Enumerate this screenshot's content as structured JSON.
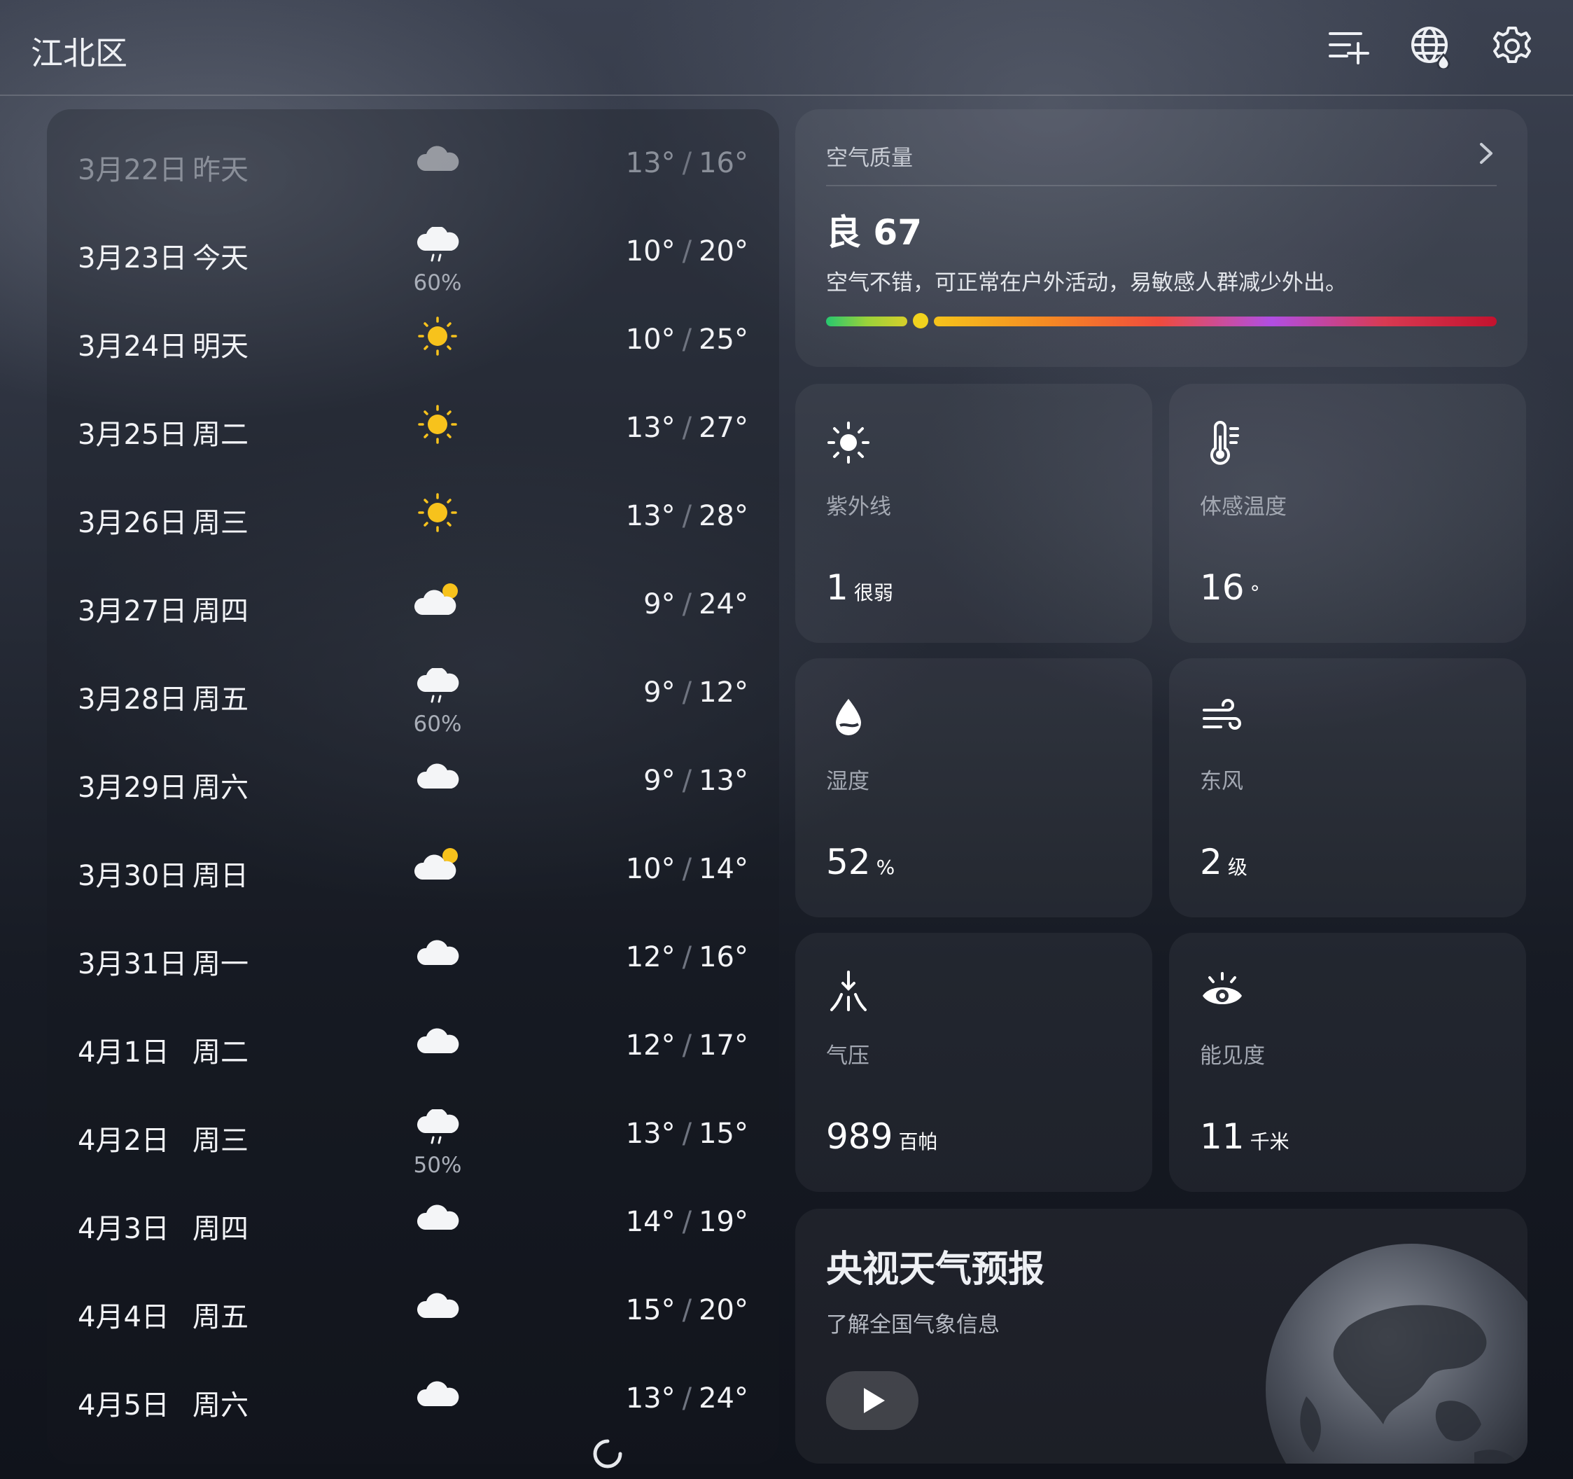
{
  "header": {
    "city": "江北区",
    "icons": [
      "add-list-icon",
      "globe-icon",
      "settings-icon"
    ]
  },
  "forecast": [
    {
      "date": "3月22日",
      "day": "昨天",
      "icon": "cloud-icon",
      "precip": "",
      "low": "13°",
      "high": "16°",
      "past": true
    },
    {
      "date": "3月23日",
      "day": "今天",
      "icon": "rain-icon",
      "precip": "60%",
      "low": "10°",
      "high": "20°",
      "past": false
    },
    {
      "date": "3月24日",
      "day": "明天",
      "icon": "sun-icon",
      "precip": "",
      "low": "10°",
      "high": "25°",
      "past": false
    },
    {
      "date": "3月25日",
      "day": "周二",
      "icon": "sun-icon",
      "precip": "",
      "low": "13°",
      "high": "27°",
      "past": false
    },
    {
      "date": "3月26日",
      "day": "周三",
      "icon": "sun-icon",
      "precip": "",
      "low": "13°",
      "high": "28°",
      "past": false
    },
    {
      "date": "3月27日",
      "day": "周四",
      "icon": "partly-cloudy-icon",
      "precip": "",
      "low": "9°",
      "high": "24°",
      "past": false
    },
    {
      "date": "3月28日",
      "day": "周五",
      "icon": "rain-icon",
      "precip": "60%",
      "low": "9°",
      "high": "12°",
      "past": false
    },
    {
      "date": "3月29日",
      "day": "周六",
      "icon": "cloud-icon",
      "precip": "",
      "low": "9°",
      "high": "13°",
      "past": false
    },
    {
      "date": "3月30日",
      "day": "周日",
      "icon": "partly-cloudy-icon",
      "precip": "",
      "low": "10°",
      "high": "14°",
      "past": false
    },
    {
      "date": "3月31日",
      "day": "周一",
      "icon": "cloud-icon",
      "precip": "",
      "low": "12°",
      "high": "16°",
      "past": false
    },
    {
      "date": "4月1日",
      "day": "周二",
      "icon": "cloud-icon",
      "precip": "",
      "low": "12°",
      "high": "17°",
      "past": false
    },
    {
      "date": "4月2日",
      "day": "周三",
      "icon": "rain-icon",
      "precip": "50%",
      "low": "13°",
      "high": "15°",
      "past": false
    },
    {
      "date": "4月3日",
      "day": "周四",
      "icon": "cloud-icon",
      "precip": "",
      "low": "14°",
      "high": "19°",
      "past": false
    },
    {
      "date": "4月4日",
      "day": "周五",
      "icon": "cloud-icon",
      "precip": "",
      "low": "15°",
      "high": "20°",
      "past": false
    },
    {
      "date": "4月5日",
      "day": "周六",
      "icon": "cloud-icon",
      "precip": "",
      "low": "13°",
      "high": "24°",
      "past": false
    }
  ],
  "air_quality": {
    "title": "空气质量",
    "main": "良 67",
    "description": "空气不错，可正常在户外活动，易敏感人群减少外出。",
    "aqi": 67
  },
  "tiles": [
    {
      "id": "uv",
      "icon": "sun-outline-icon",
      "label": "紫外线",
      "value": "1",
      "unit": "很弱"
    },
    {
      "id": "feels-like",
      "icon": "thermometer-icon",
      "label": "体感温度",
      "value": "16",
      "unit": "°"
    },
    {
      "id": "humidity",
      "icon": "droplet-icon",
      "label": "湿度",
      "value": "52",
      "unit": "%"
    },
    {
      "id": "wind",
      "icon": "wind-icon",
      "label": "东风",
      "value": "2",
      "unit": "级"
    },
    {
      "id": "pressure",
      "icon": "pressure-icon",
      "label": "气压",
      "value": "989",
      "unit": "百帕"
    },
    {
      "id": "visibility",
      "icon": "eye-icon",
      "label": "能见度",
      "value": "11",
      "unit": "千米"
    }
  ],
  "tv": {
    "title": "央视天气预报",
    "subtitle": "了解全国气象信息"
  },
  "colors": {
    "sun": "#f7c21c",
    "aq_good": "#f1d21e",
    "aq_red": "#c3122e"
  }
}
